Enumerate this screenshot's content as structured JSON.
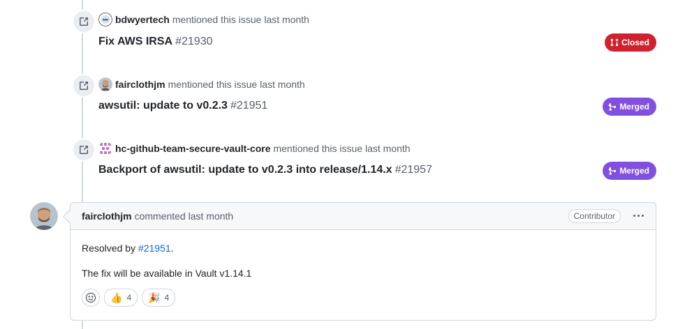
{
  "events": [
    {
      "author": "bdwyertech",
      "action": "mentioned this issue last month",
      "title": "Fix AWS IRSA",
      "number": "#21930",
      "state": "Closed"
    },
    {
      "author": "fairclothjm",
      "action": "mentioned this issue last month",
      "title": "awsutil: update to v0.2.3",
      "number": "#21951",
      "state": "Merged"
    },
    {
      "author": "hc-github-team-secure-vault-core",
      "action": "mentioned this issue last month",
      "title": "Backport of awsutil: update to v0.2.3 into release/1.14.x",
      "number": "#21957",
      "state": "Merged"
    }
  ],
  "comment": {
    "author": "fairclothjm",
    "meta": "commented last month",
    "role": "Contributor",
    "body_prefix": "Resolved by ",
    "body_link": "#21951",
    "body_suffix": ".",
    "body_line2": "The fix will be available in Vault v1.14.1",
    "reactions": [
      {
        "emoji": "👍",
        "count": "4"
      },
      {
        "emoji": "🎉",
        "count": "4"
      }
    ]
  },
  "colors": {
    "closed": "#cf222e",
    "merged": "#8250df",
    "link": "#0969da"
  },
  "icons": {
    "event": "cross-reference-icon",
    "closed": "pull-request-closed-icon",
    "merged": "merge-icon",
    "more": "kebab-horizontal-icon",
    "emoji": "smiley-icon"
  }
}
